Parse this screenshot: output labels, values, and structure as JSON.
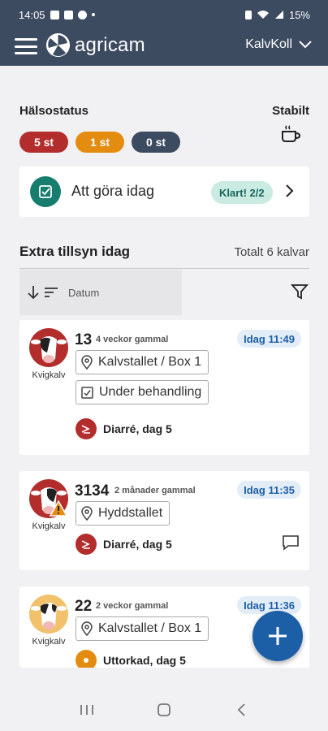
{
  "status_bar": {
    "time": "14:05",
    "battery": "15%"
  },
  "app_bar": {
    "logo_text": "agricam",
    "farm_name": "KalvKoll"
  },
  "health": {
    "title": "Hälsostatus",
    "stable_label": "Stabilt",
    "pills": [
      {
        "label": "5 st",
        "color": "#b32d2d"
      },
      {
        "label": "1 st",
        "color": "#e38c10"
      },
      {
        "label": "0 st",
        "color": "#3d4b61"
      }
    ]
  },
  "todo": {
    "label": "Att göra idag",
    "badge": "Klart! 2/2"
  },
  "extra": {
    "title": "Extra tillsyn idag",
    "total": "Totalt 6 kalvar",
    "sort_label": "Datum"
  },
  "calves": [
    {
      "id": "13",
      "age": "4 veckor gammal",
      "type": "Kvigkalv",
      "time": "Idag 11:49",
      "location": "Kalvstallet / Box 1",
      "treatment": "Under behandling",
      "diagnosis": "Diarré, dag 5",
      "diagnosis_color": "#b32d2d",
      "avatar_color": "#b32d2d",
      "warning": false
    },
    {
      "id": "3134",
      "age": "2 månader gammal",
      "type": "Kvigkalv",
      "time": "Idag 11:35",
      "location": "Hyddstallet",
      "diagnosis": "Diarré, dag 5",
      "diagnosis_color": "#b32d2d",
      "avatar_color": "#b32d2d",
      "warning": true
    },
    {
      "id": "22",
      "age": "2 veckor gammal",
      "type": "Kvigkalv",
      "time": "Idag 11:36",
      "location": "Kalvstallet / Box 1",
      "diagnosis": "Uttorkad, dag 5",
      "diagnosis_color": "#e38c10",
      "avatar_color": "#f2c16b",
      "warning": false
    }
  ],
  "colors": {
    "header": "#3d4b61",
    "accent": "#1c5fa6",
    "todo_green": "#177d6e"
  }
}
